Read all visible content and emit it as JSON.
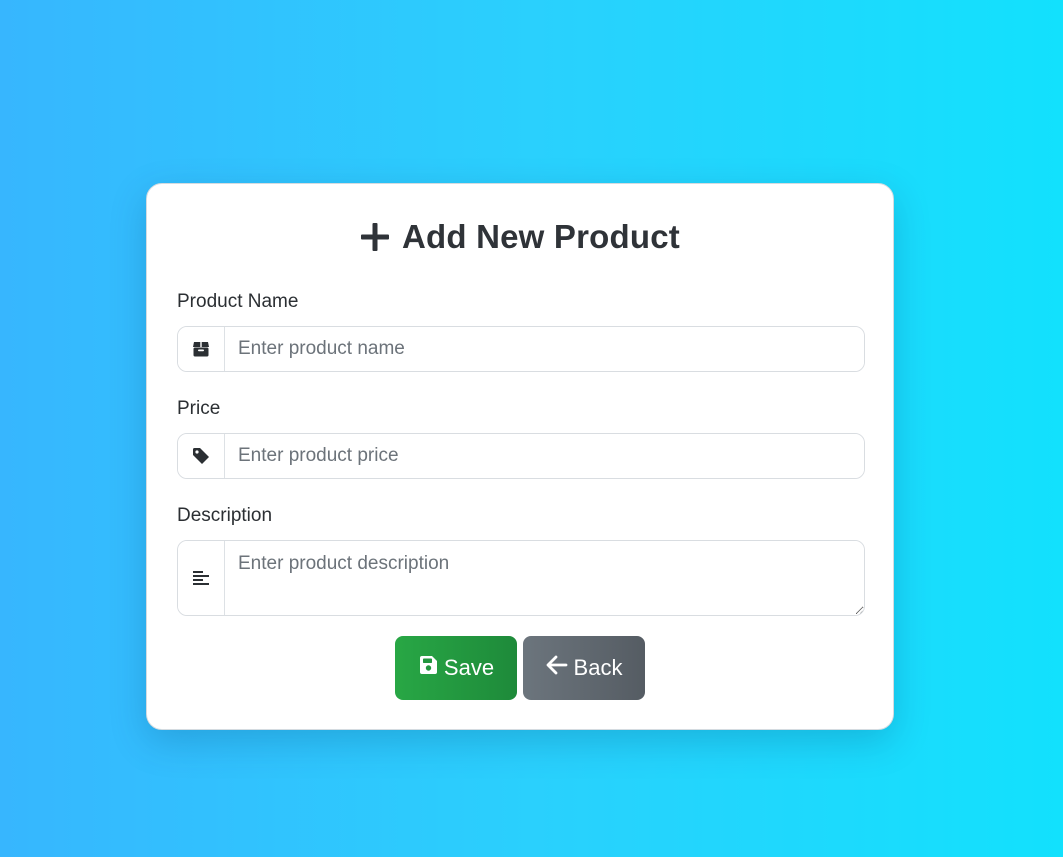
{
  "form": {
    "title": "Add New Product",
    "fields": [
      {
        "label": "Product Name",
        "placeholder": "Enter product name",
        "value": "",
        "icon": "box-icon"
      },
      {
        "label": "Price",
        "placeholder": "Enter product price",
        "value": "",
        "icon": "tag-icon"
      },
      {
        "label": "Description",
        "placeholder": "Enter product description",
        "value": "",
        "icon": "align-left-icon"
      }
    ],
    "buttons": {
      "save_label": "Save",
      "back_label": "Back"
    }
  },
  "colors": {
    "background_start": "#37b6fe",
    "background_end": "#12e1fd",
    "save_button": "#28a745",
    "back_button": "#6c757d",
    "text": "#2b2f33"
  }
}
